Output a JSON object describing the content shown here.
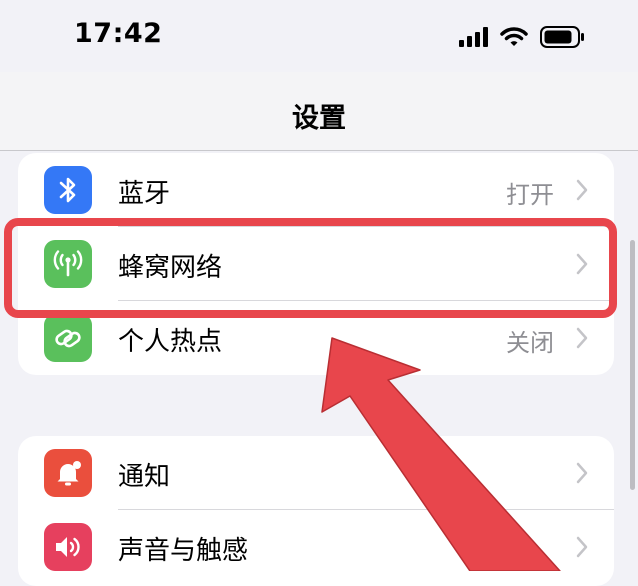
{
  "status_bar": {
    "time": "17:42"
  },
  "nav": {
    "title": "设置"
  },
  "groups": [
    {
      "rows": [
        {
          "label": "蓝牙",
          "value": "打开",
          "icon": "bluetooth-icon",
          "color": "#3478f6"
        },
        {
          "label": "蜂窝网络",
          "value": "",
          "icon": "cellular-antenna-icon",
          "color": "#5ac05c"
        },
        {
          "label": "个人热点",
          "value": "关闭",
          "icon": "personal-hotspot-icon",
          "color": "#5ac05c"
        }
      ]
    },
    {
      "rows": [
        {
          "label": "通知",
          "icon": "notification-bell-icon",
          "color": "#ea4f3d"
        },
        {
          "label": "声音与触感",
          "icon": "speaker-icon",
          "color": "#e6405e"
        }
      ]
    }
  ],
  "annotation": {
    "color": "#e8464c"
  }
}
